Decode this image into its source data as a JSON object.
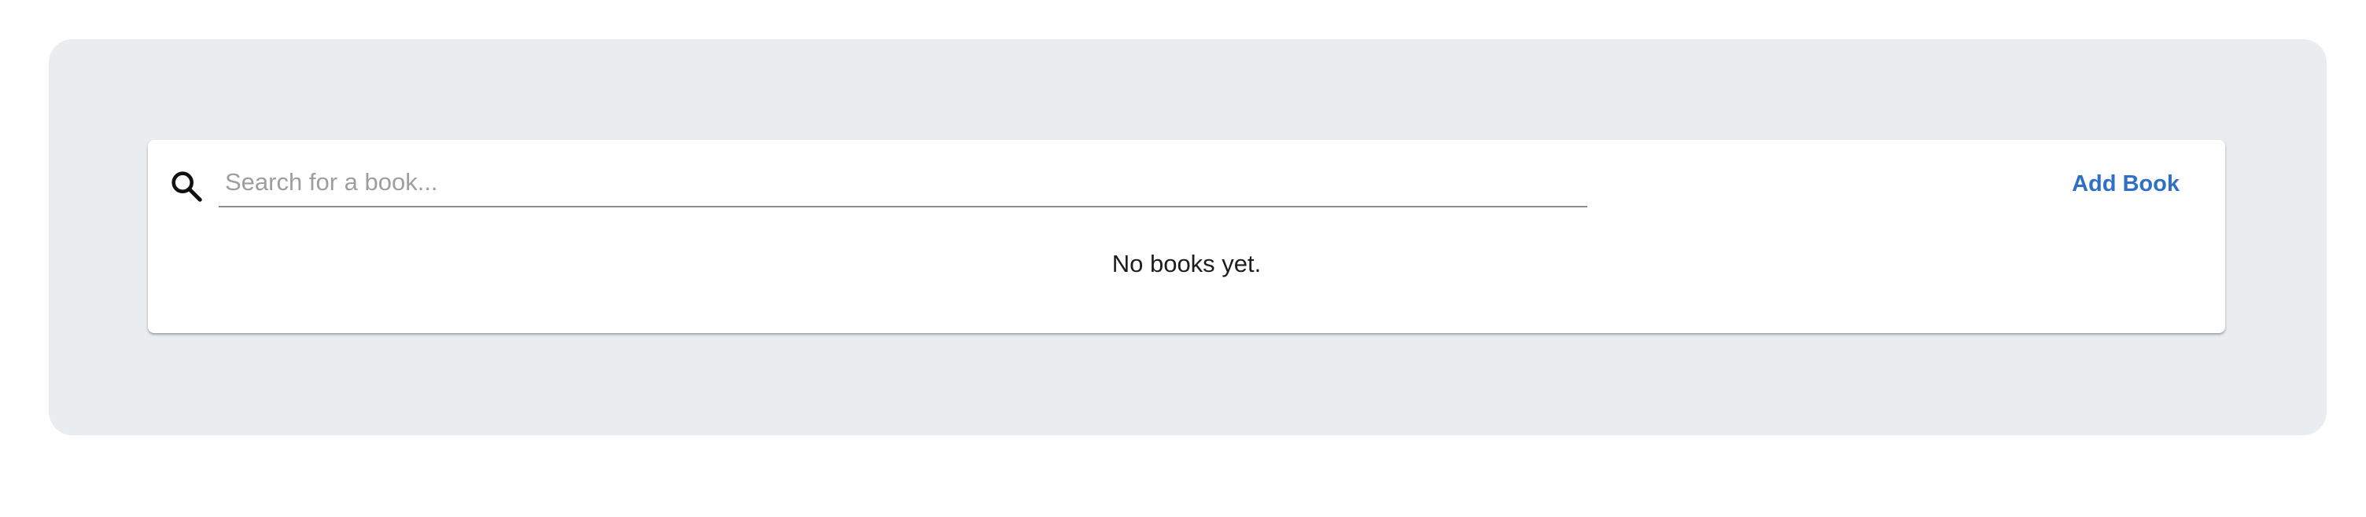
{
  "search": {
    "placeholder": "Search for a book...",
    "value": "",
    "icon": "search-icon"
  },
  "toolbar": {
    "add_book_label": "Add Book"
  },
  "books": {
    "items": [],
    "empty_message": "No books yet."
  },
  "colors": {
    "page_background": "#ffffff",
    "panel_background": "#e9edf0",
    "card_background": "#ffffff",
    "accent": "#2f6fc6",
    "placeholder_text": "#9e9e9e",
    "body_text": "#1d1d1d"
  }
}
